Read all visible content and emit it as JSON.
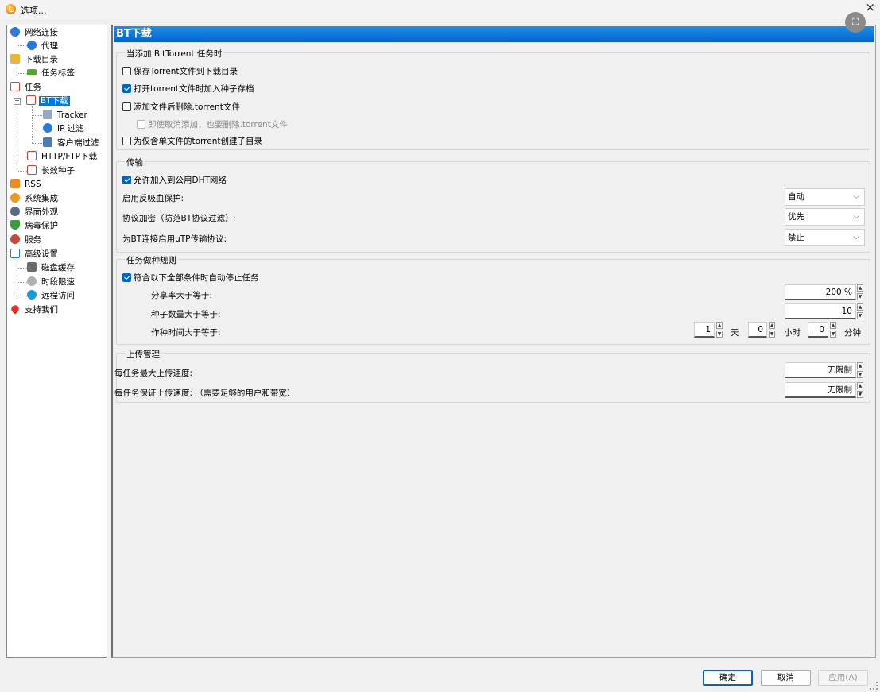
{
  "window": {
    "title": "选项...",
    "close_glyph": "×"
  },
  "tree": {
    "items": [
      {
        "label": "网络连接",
        "icon": "globe-icon",
        "color": "#2b7bd6"
      },
      {
        "label": "代理",
        "icon": "proxy-globe-icon",
        "color": "#2b7bd6"
      },
      {
        "label": "下载目录",
        "icon": "folder-icon",
        "color": "#e8b739"
      },
      {
        "label": "任务标签",
        "icon": "tag-icon",
        "color": "#5aa52e"
      },
      {
        "label": "任务",
        "icon": "task-icon",
        "color": "#c24a3a"
      },
      {
        "label": "BT下载",
        "icon": "bt-task-icon",
        "color": "#c24a3a"
      },
      {
        "label": "Tracker",
        "icon": "tracker-icon",
        "color": "#7a8ba8"
      },
      {
        "label": "IP 过滤",
        "icon": "ip-filter-icon",
        "color": "#2b7bd6"
      },
      {
        "label": "客户端过滤",
        "icon": "client-filter-icon",
        "color": "#4d7bb4"
      },
      {
        "label": "HTTP/FTP下载",
        "icon": "http-task-icon",
        "color": "#c24a3a"
      },
      {
        "label": "长效种子",
        "icon": "long-seed-icon",
        "color": "#c24a3a"
      },
      {
        "label": "RSS",
        "icon": "rss-icon",
        "color": "#f08a1c"
      },
      {
        "label": "系统集成",
        "icon": "integration-icon",
        "color": "#e79b22"
      },
      {
        "label": "界面外观",
        "icon": "appearance-icon",
        "color": "#5a6b8a"
      },
      {
        "label": "病毒保护",
        "icon": "shield-icon",
        "color": "#3a9b3a"
      },
      {
        "label": "服务",
        "icon": "service-icon",
        "color": "#c24a3a"
      },
      {
        "label": "高级设置",
        "icon": "advanced-icon",
        "color": "#2b7bd6"
      },
      {
        "label": "磁盘缓存",
        "icon": "disk-cache-icon",
        "color": "#6b6b6b"
      },
      {
        "label": "时段限速",
        "icon": "time-limit-icon",
        "color": "#8a8a8a"
      },
      {
        "label": "远程访问",
        "icon": "remote-access-icon",
        "color": "#1c9bd6"
      },
      {
        "label": "支持我们",
        "icon": "heart-icon",
        "color": "#d9342b"
      }
    ],
    "expander_glyph": "−"
  },
  "panel": {
    "title": "BT下载",
    "group_add": {
      "title": "当添加 BitTorrent 任务时",
      "options": [
        {
          "label": "保存Torrent文件到下载目录",
          "checked": false
        },
        {
          "label": "打开torrent文件时加入种子存档",
          "checked": true
        },
        {
          "label": "添加文件后删除.torrent文件",
          "checked": false
        },
        {
          "label": "即使取消添加，也要删除.torrent文件",
          "checked": false,
          "disabled": true
        },
        {
          "label": "为仅含单文件的torrent创建子目录",
          "checked": false
        }
      ]
    },
    "group_transfer": {
      "title": "传输",
      "dht_label": "允许加入到公用DHT网络",
      "dht_checked": true,
      "anti_leech_label": "启用反吸血保护:",
      "anti_leech_value": "自动",
      "encryption_label": "协议加密（防范BT协议过滤）:",
      "encryption_value": "优先",
      "utp_label": "为BT连接启用uTP传输协议:",
      "utp_value": "禁止",
      "arrow": "⌵"
    },
    "group_seeding": {
      "title": "任务做种规则",
      "auto_stop_label": "符合以下全部条件时自动停止任务",
      "auto_stop_checked": true,
      "ratio_label": "分享率大于等于:",
      "ratio_value": "200 %",
      "seeds_label": "种子数量大于等于:",
      "seeds_value": "10",
      "time_label": "作种时间大于等于:",
      "days_value": "1",
      "days_unit": "天",
      "hours_value": "0",
      "hours_unit": "小时",
      "minutes_value": "0",
      "minutes_unit": "分钟"
    },
    "group_upload": {
      "title": "上传管理",
      "max_label": "每任务最大上传速度:",
      "max_value": "无限制",
      "guarantee_label": "每任务保证上传速度: （需要足够的用户和带宽）",
      "guarantee_value": "无限制"
    }
  },
  "buttons": {
    "ok": "确定",
    "cancel": "取消",
    "apply": "应用(A)"
  },
  "spin_up": "▲",
  "spin_down": "▼"
}
